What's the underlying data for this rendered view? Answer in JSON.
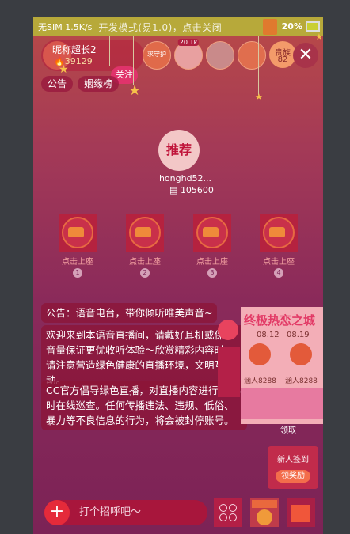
{
  "status_bar": {
    "network": "无SIM 1.5K/s",
    "dev_notice": "开发模式(易1.0)，点击关闭",
    "battery": "20%"
  },
  "anchor": {
    "name": "昵称超长2",
    "heat": "39129",
    "follow_label": "关注"
  },
  "viewers": [
    "求守护",
    "20.1k",
    "",
    ""
  ],
  "rank_badge": {
    "line1": "贵族",
    "line2": "82"
  },
  "close_label": "✕",
  "tags": [
    "公告",
    "姻缘榜"
  ],
  "host": {
    "badge": "推荐",
    "name": "honghd52...",
    "value": "105600"
  },
  "seats": [
    {
      "label": "点击上座",
      "num": "1"
    },
    {
      "label": "点击上座",
      "num": "2"
    },
    {
      "label": "点击上座",
      "num": "3"
    },
    {
      "label": "点击上座",
      "num": "4"
    }
  ],
  "chat": {
    "notice": "公告：语音电台，带你倾听唯美声音~",
    "welcome": "欢迎来到本语音直播间，请戴好耳机或保持音量保证更优收听体验～欣赏精彩内容时，请注意营造绿色健康的直播环境，文明互动。",
    "official": "CC官方倡导绿色直播，对直播内容进行24小时在线巡查。任何传播违法、违规、低俗、暴力等不良信息的行为，将会被封停账号。"
  },
  "promo": {
    "title": "终极热恋之城",
    "date1": "08.12",
    "date2": "08.19",
    "count1": "涵人8288",
    "count2": "涵人8288",
    "claim": "领取"
  },
  "new_user": {
    "line1": "新人签到",
    "line2": "领奖励"
  },
  "input": {
    "placeholder": "打个招呼吧～",
    "plus": "+"
  },
  "colors": {
    "accent": "#e52a3a",
    "status_bg": "#b7a93a"
  }
}
